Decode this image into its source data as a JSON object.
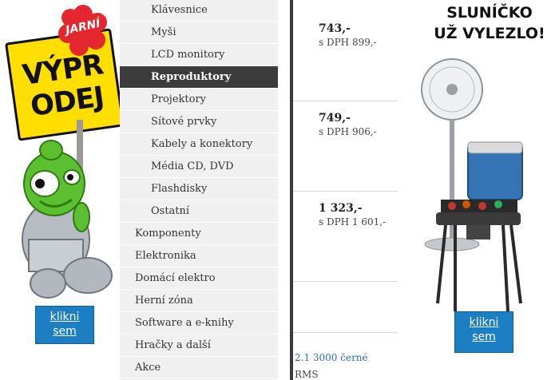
{
  "left_banner": {
    "sign_line1": "VÝPR",
    "sign_line2": "ODEJ",
    "flower_text": "JARNÍ",
    "button_line1": "klikni",
    "button_line2": "sem"
  },
  "menu": {
    "items": [
      {
        "label": "Klávesnice",
        "level": "sub",
        "active": false
      },
      {
        "label": "Myši",
        "level": "sub",
        "active": false
      },
      {
        "label": "LCD monitory",
        "level": "sub",
        "active": false
      },
      {
        "label": "Reproduktory",
        "level": "sub",
        "active": true
      },
      {
        "label": "Projektory",
        "level": "sub",
        "active": false
      },
      {
        "label": "Sítové prvky",
        "level": "sub",
        "active": false
      },
      {
        "label": "Kabely a konektory",
        "level": "sub",
        "active": false
      },
      {
        "label": "Média CD, DVD",
        "level": "sub",
        "active": false
      },
      {
        "label": "Flashdisky",
        "level": "sub",
        "active": false
      },
      {
        "label": "Ostatní",
        "level": "sub",
        "active": false
      },
      {
        "label": "Komponenty",
        "level": "top",
        "active": false
      },
      {
        "label": "Elektronika",
        "level": "top",
        "active": false
      },
      {
        "label": "Domácí elektro",
        "level": "top",
        "active": false
      },
      {
        "label": "Herní zóna",
        "level": "top",
        "active": false
      },
      {
        "label": "Software a e-knihy",
        "level": "top",
        "active": false
      },
      {
        "label": "Hračky a další",
        "level": "top",
        "active": false
      },
      {
        "label": "Akce",
        "level": "top",
        "active": false
      }
    ]
  },
  "products": {
    "items": [
      {
        "price": "743,-",
        "price_vat": "s DPH 899,-"
      },
      {
        "price": "749,-",
        "price_vat": "s DPH 906,-"
      },
      {
        "price": "1 323,-",
        "price_vat": "s DPH 1 601,-"
      }
    ],
    "bottom_link": "2.1 3000 černé",
    "bottom_text": "RMS"
  },
  "right_banner": {
    "title_line1": "SLUNÍČKO",
    "title_line2": "UŽ VYLEZLO!",
    "button_line1": "klikni",
    "button_line2": "sem"
  },
  "colors": {
    "menu_bg": "#f0f0f0",
    "menu_active_bg": "#3c3c3c",
    "button_blue": "#1c7fc3",
    "sign_yellow": "#ffde00",
    "link_blue": "#2a6ea8"
  }
}
